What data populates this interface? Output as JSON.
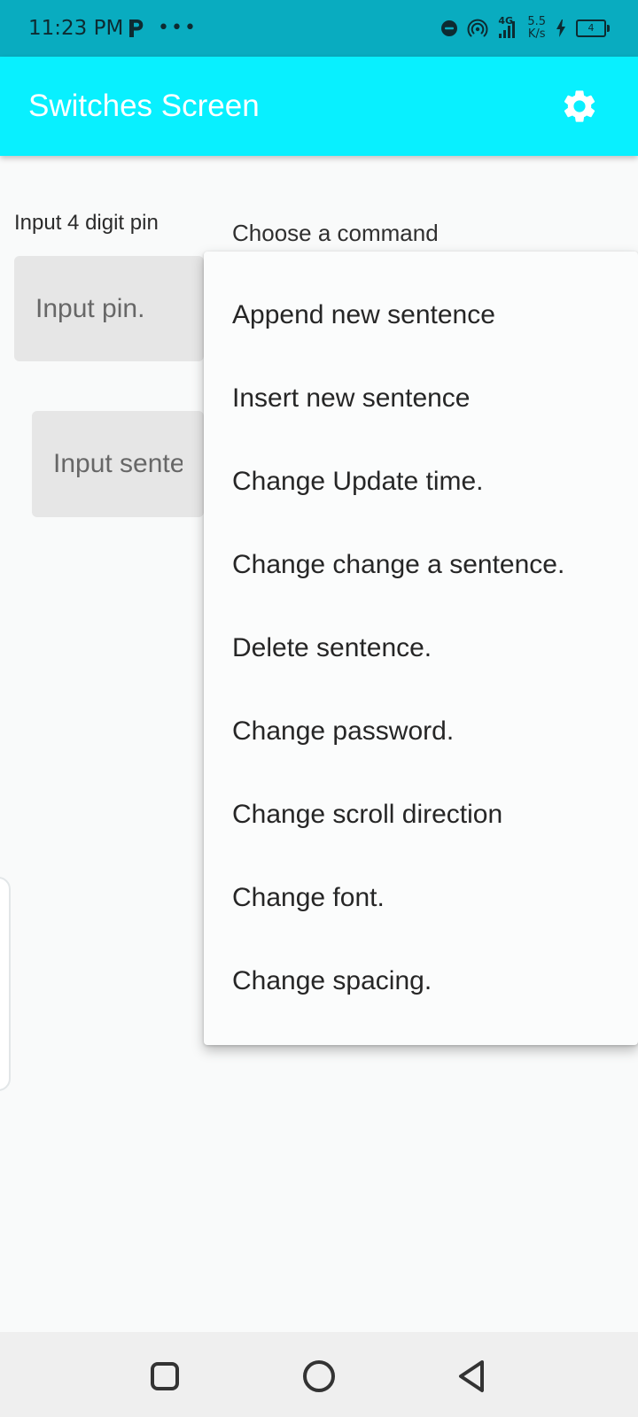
{
  "status_bar": {
    "time": "11:23 PM",
    "more_indicator": "•••",
    "network_type": "4G",
    "net_speed_value": "5.5",
    "net_speed_unit": "K/s",
    "battery_level": "4",
    "icons": [
      "parking-app-icon",
      "do-not-disturb-icon",
      "hotspot-icon",
      "signal-icon",
      "charging-icon",
      "battery-icon"
    ]
  },
  "app_bar": {
    "title": "Switches Screen",
    "settings_icon": "gear-icon"
  },
  "form": {
    "pin_label": "Input 4 digit pin",
    "pin_placeholder": "Input pin.",
    "sentence_placeholder": "Input sentence"
  },
  "command_dropdown": {
    "label": "Choose a command",
    "items": [
      "Append new sentence",
      "Insert new sentence",
      "Change Update time.",
      "Change change a sentence.",
      "Delete sentence.",
      "Change password.",
      "Change scroll direction",
      "Change font.",
      "Change spacing."
    ]
  },
  "colors": {
    "status_bar": "#09acc0",
    "app_bar": "#08f0ff",
    "background": "#f9fafa",
    "input_background": "#e6e6e6",
    "title_text": "#ffffff"
  },
  "navigation_bar": {
    "buttons": [
      "recent-apps-icon",
      "home-icon",
      "back-icon"
    ]
  }
}
